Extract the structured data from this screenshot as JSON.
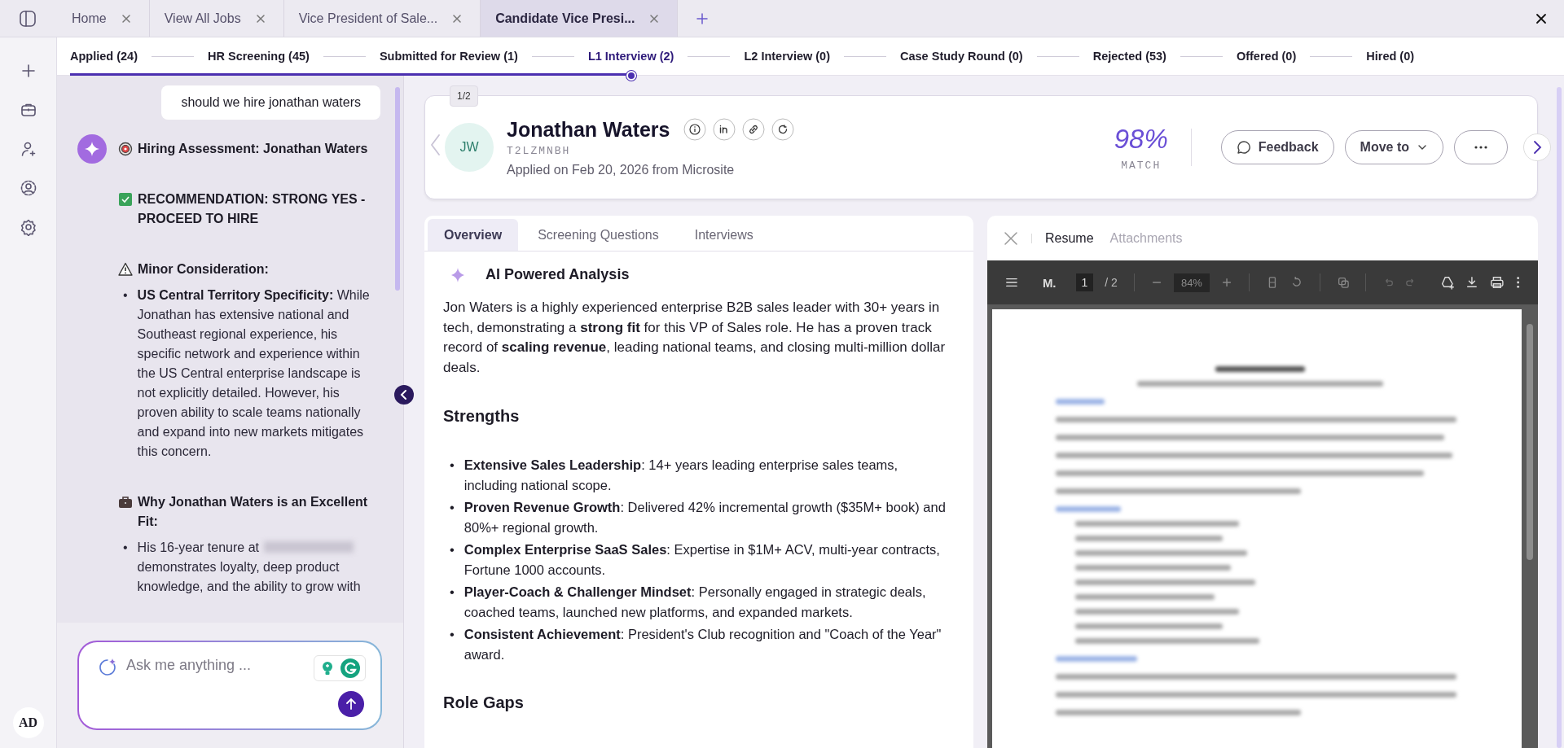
{
  "tabs": [
    {
      "label": "Home",
      "selected": false
    },
    {
      "label": "View All Jobs",
      "selected": false
    },
    {
      "label": "Vice President of Sale...",
      "selected": false
    },
    {
      "label": "Candidate Vice Presi...",
      "selected": true
    }
  ],
  "stages": [
    {
      "label": "Applied (24)",
      "selected": false
    },
    {
      "label": "HR Screening (45)",
      "selected": false
    },
    {
      "label": "Submitted for Review (1)",
      "selected": false
    },
    {
      "label": "L1 Interview (2)",
      "selected": true
    },
    {
      "label": "L2 Interview (0)",
      "selected": false
    },
    {
      "label": "Case Study Round (0)",
      "selected": false
    },
    {
      "label": "Rejected (53)",
      "selected": false
    },
    {
      "label": "Offered (0)",
      "selected": false
    },
    {
      "label": "Hired (0)",
      "selected": false
    }
  ],
  "user": {
    "initials": "AD"
  },
  "chat": {
    "user_message": "should we hire jonathan waters",
    "marker": "•",
    "blocks": [
      {
        "kind": "title",
        "text": "Hiring Assessment: Jonathan Waters"
      },
      {
        "kind": "verdict",
        "text": "RECOMMENDATION: STRONG YES - PROCEED TO HIRE"
      },
      {
        "kind": "caution",
        "text": "Minor Consideration:",
        "points": [
          {
            "text": "**US Central Territory Specificity:** While Jonathan has extensive national and Southeast regional experience, his specific network and experience within the US Central enterprise landscape is not explicitly detailed. However, his proven ability to scale teams nationally and expand into new markets mitigates this concern."
          }
        ]
      },
      {
        "kind": "reason",
        "text": "Why Jonathan Waters is an Excellent Fit:",
        "points": [
          {
            "before": "His 16-year tenure at",
            "after": "demonstrates loyalty, deep product knowledge, and the ability to grow with"
          }
        ]
      }
    ],
    "input": {
      "placeholder": "Ask me anything ..."
    }
  },
  "candidate": {
    "pager": "1/2",
    "initials": "JW",
    "name": "Jonathan Waters",
    "code": "T2LZMNBH",
    "applied": "Applied on Feb 20, 2026 from Microsite",
    "match": "98%",
    "match_label": "MATCH",
    "feedback": "Feedback",
    "move": "Move to"
  },
  "overview": {
    "tabs": [
      {
        "label": "Overview",
        "selected": true
      },
      {
        "label": "Screening Questions",
        "selected": false
      },
      {
        "label": "Interviews",
        "selected": false
      }
    ],
    "analysis_title": "AI Powered Analysis",
    "summary": "Jon Waters is a highly experienced enterprise B2B sales leader with 30+ years in tech, demonstrating a **strong fit** for this VP of Sales role. He has a proven track record of **scaling revenue**, leading national teams, and closing multi-million dollar deals.",
    "strengths_title": "Strengths",
    "marker": "•",
    "strengths": [
      "**Extensive Sales Leadership**: 14+ years leading enterprise sales teams, including national scope.",
      "**Proven Revenue Growth**: Delivered 42% incremental growth ($35M+ book) and 80%+ regional growth.",
      "**Complex Enterprise SaaS Sales**: Expertise in $1M+ ACV, multi-year contracts, Fortune 1000 accounts.",
      "**Player-Coach & Challenger Mindset**: Personally engaged in strategic deals, coached teams, launched new platforms, and expanded markets.",
      "**Consistent Achievement**: President's Club recognition and \"Coach of the Year\" award."
    ],
    "gaps_title": "Role Gaps"
  },
  "resume": {
    "tabs": [
      {
        "label": "Resume",
        "selected": true
      },
      {
        "label": "Attachments",
        "selected": false
      }
    ],
    "viewer": {
      "title": "M.",
      "page": "1",
      "pages": "/ 2",
      "zoom": "84%"
    }
  }
}
